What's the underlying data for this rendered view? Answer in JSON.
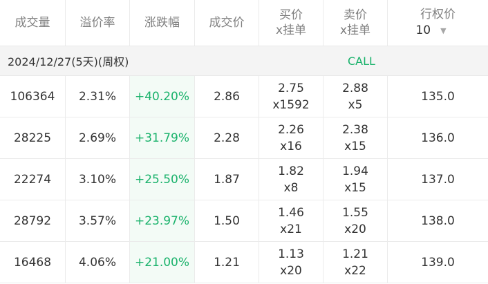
{
  "headers": {
    "volume": "成交量",
    "premium": "溢价率",
    "change": "涨跌幅",
    "last": "成交价",
    "bid_line1": "买价",
    "bid_line2": "x挂单",
    "ask_line1": "卖价",
    "ask_line2": "x挂单",
    "strike_line1": "行权价",
    "strike_selector_value": "10"
  },
  "group": {
    "expiry": "2024/12/27(5天)(周权)",
    "side": "CALL"
  },
  "rows": [
    {
      "volume": "106364",
      "premium": "2.31%",
      "change": "+40.20%",
      "last": "2.86",
      "bid": "2.75",
      "bid_size": "x1592",
      "ask": "2.88",
      "ask_size": "x5",
      "strike": "135.0"
    },
    {
      "volume": "28225",
      "premium": "2.69%",
      "change": "+31.79%",
      "last": "2.28",
      "bid": "2.26",
      "bid_size": "x16",
      "ask": "2.38",
      "ask_size": "x15",
      "strike": "136.0"
    },
    {
      "volume": "22274",
      "premium": "3.10%",
      "change": "+25.50%",
      "last": "1.87",
      "bid": "1.82",
      "bid_size": "x8",
      "ask": "1.94",
      "ask_size": "x15",
      "strike": "137.0"
    },
    {
      "volume": "28792",
      "premium": "3.57%",
      "change": "+23.97%",
      "last": "1.50",
      "bid": "1.46",
      "bid_size": "x21",
      "ask": "1.55",
      "ask_size": "x20",
      "strike": "138.0"
    },
    {
      "volume": "16468",
      "premium": "4.06%",
      "change": "+21.00%",
      "last": "1.21",
      "bid": "1.13",
      "bid_size": "x20",
      "ask": "1.21",
      "ask_size": "x22",
      "strike": "139.0"
    }
  ],
  "colors": {
    "positive": "#19b26b",
    "header_text": "#808080",
    "group_bg": "#f4f4f4"
  }
}
